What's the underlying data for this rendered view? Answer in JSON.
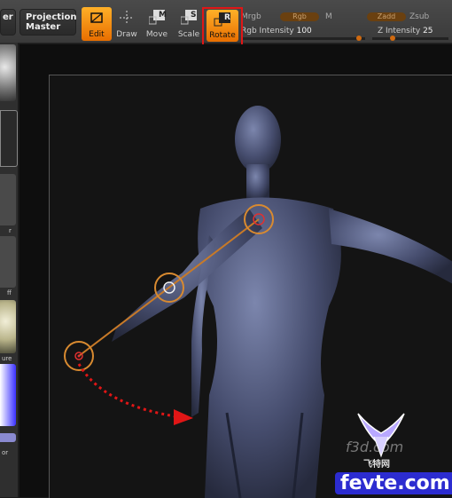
{
  "header": {
    "left_cut_label": "er",
    "projection_master_line1": "Projection",
    "projection_master_line2": "Master"
  },
  "tools": {
    "edit": "Edit",
    "draw": "Draw",
    "move": "Move",
    "move_key": "M",
    "scale": "Scale",
    "scale_key": "S",
    "rotate": "Rotate",
    "rotate_key": "R"
  },
  "rgb": {
    "mrgb": "Mrgb",
    "rgb_pill": "Rgb",
    "m": "M",
    "zadd": "Zadd",
    "zsub": "Zsub",
    "rgb_intensity_label": "Rgb Intensity",
    "rgb_intensity_value": "100",
    "z_intensity_label": "Z Intensity",
    "z_intensity_value": "25",
    "accent": "#e87a10"
  },
  "left_panel": {
    "labels": [
      "r",
      "ff",
      "ure",
      "or"
    ]
  },
  "watermark": {
    "site_top": "f3d.com",
    "site_bottom": "fevte.com",
    "brand": "飞特网"
  },
  "annotation": {
    "highlight_color": "#e01616",
    "arrow_color": "#e01616"
  }
}
